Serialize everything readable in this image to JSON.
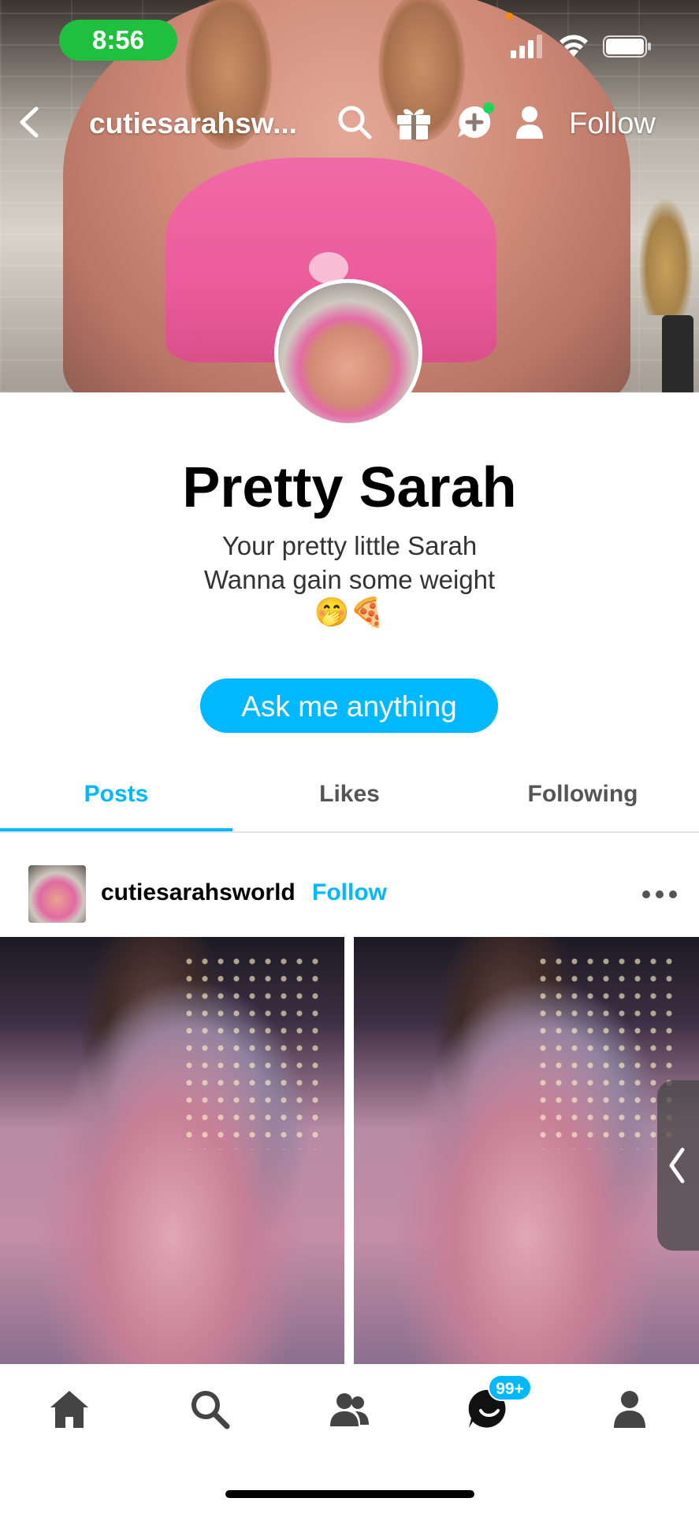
{
  "status_bar": {
    "time": "8:56"
  },
  "header": {
    "blog_name": "cutiesarahsw...",
    "follow_label": "Follow",
    "icons": [
      "back-chevron-icon",
      "search-icon",
      "gift-icon",
      "chat-plus-icon",
      "person-icon"
    ]
  },
  "profile": {
    "name": "Pretty Sarah",
    "bio_lines": [
      "Your pretty little Sarah",
      "Wanna gain some weight"
    ],
    "bio_emoji": "🤭🍕",
    "ask_button": "Ask me anything"
  },
  "tabs": [
    {
      "label": "Posts",
      "active": true
    },
    {
      "label": "Likes",
      "active": false
    },
    {
      "label": "Following",
      "active": false
    }
  ],
  "post": {
    "username": "cutiesarahsworld",
    "follow_label": "Follow"
  },
  "bottom_nav": {
    "items": [
      "home-icon",
      "search-icon",
      "people-icon",
      "activity-icon",
      "account-icon"
    ],
    "badge": "99+"
  },
  "colors": {
    "accent": "#00b8ff",
    "status_green": "#1fbf3f"
  }
}
